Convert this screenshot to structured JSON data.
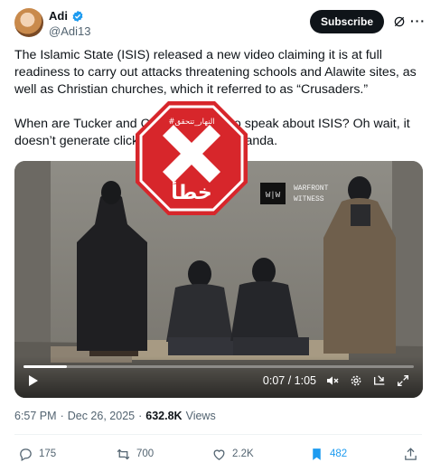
{
  "author": {
    "name": "Adi",
    "handle": "@Adi13",
    "verified": true
  },
  "header": {
    "subscribe_label": "Subscribe"
  },
  "tweet": {
    "paragraph1": "The Islamic State (ISIS) released a new video claiming it is at full readiness to carry out attacks threatening schools and Alawite sites, as well as Christian churches, which it referred to as “Crusaders.”",
    "paragraph2": "When are Tucker and Candace going to speak about ISIS? Oh wait, it doesn’t generate clicks or fit their propaganda."
  },
  "video": {
    "watermark_line1": "WARFRONT",
    "watermark_line2": "WITNESS",
    "current_time": "0:07",
    "duration": "1:05",
    "time_display": "0:07 / 1:05",
    "progress_fraction": 0.11
  },
  "stamp": {
    "top_text": "#النهار_تتحقق",
    "bottom_text": "خطأ",
    "color": "#d7262b"
  },
  "meta": {
    "time": "6:57 PM",
    "date": "Dec 26, 2025",
    "views_count": "632.8K",
    "views_label": "Views"
  },
  "actions": {
    "replies": "175",
    "reposts": "700",
    "likes": "2.2K",
    "bookmarks": "482"
  },
  "colors": {
    "accent": "#1d9bf0",
    "text": "#0f1419",
    "muted": "#536471"
  }
}
